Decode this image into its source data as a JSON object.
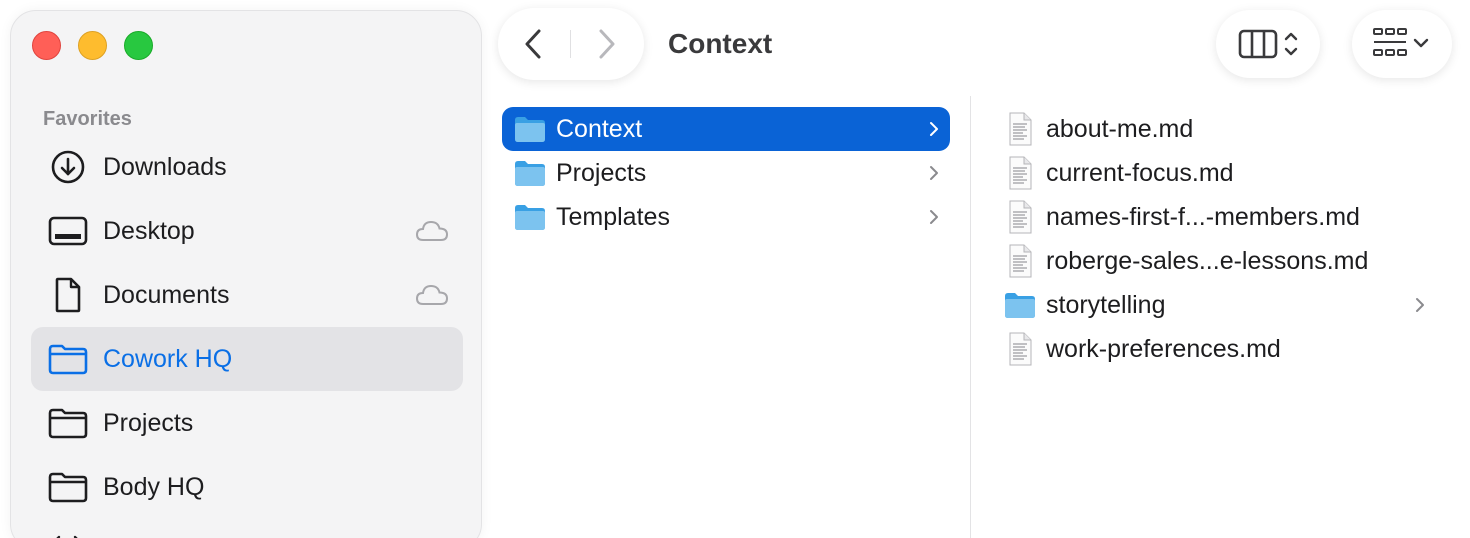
{
  "window": {
    "title": "Context"
  },
  "sidebar": {
    "section_title": "Favorites",
    "items": [
      {
        "label": "Downloads",
        "icon": "download-icon",
        "cloud": false,
        "selected": false
      },
      {
        "label": "Desktop",
        "icon": "desktop-icon",
        "cloud": true,
        "selected": false
      },
      {
        "label": "Documents",
        "icon": "document-icon",
        "cloud": true,
        "selected": false
      },
      {
        "label": "Cowork HQ",
        "icon": "folder-icon",
        "cloud": false,
        "selected": true
      },
      {
        "label": "Projects",
        "icon": "folder-icon",
        "cloud": false,
        "selected": false
      },
      {
        "label": "Body HQ",
        "icon": "folder-icon",
        "cloud": false,
        "selected": false
      }
    ]
  },
  "toolbar": {
    "back_icon": "chevron-left-icon",
    "forward_icon": "chevron-right-icon",
    "view_mode_icon": "column-view-icon",
    "group_icon": "grid-group-icon"
  },
  "columns": {
    "first": [
      {
        "label": "Context",
        "type": "folder",
        "selected": true
      },
      {
        "label": "Projects",
        "type": "folder",
        "selected": false
      },
      {
        "label": "Templates",
        "type": "folder",
        "selected": false
      }
    ],
    "second": [
      {
        "label": "about-me.md",
        "type": "file"
      },
      {
        "label": "current-focus.md",
        "type": "file"
      },
      {
        "label": "names-first-f...-members.md",
        "type": "file"
      },
      {
        "label": "roberge-sales...e-lessons.md",
        "type": "file"
      },
      {
        "label": "storytelling",
        "type": "folder"
      },
      {
        "label": "work-preferences.md",
        "type": "file"
      }
    ]
  },
  "colors": {
    "accent": "#0a63d6",
    "sidebar_selected_text": "#0a6fe6",
    "folder_light": "#7cc3ef",
    "folder_dark": "#39a0e4",
    "close": "#ff5f57",
    "minimize": "#febc2e",
    "maximize": "#28c840"
  }
}
